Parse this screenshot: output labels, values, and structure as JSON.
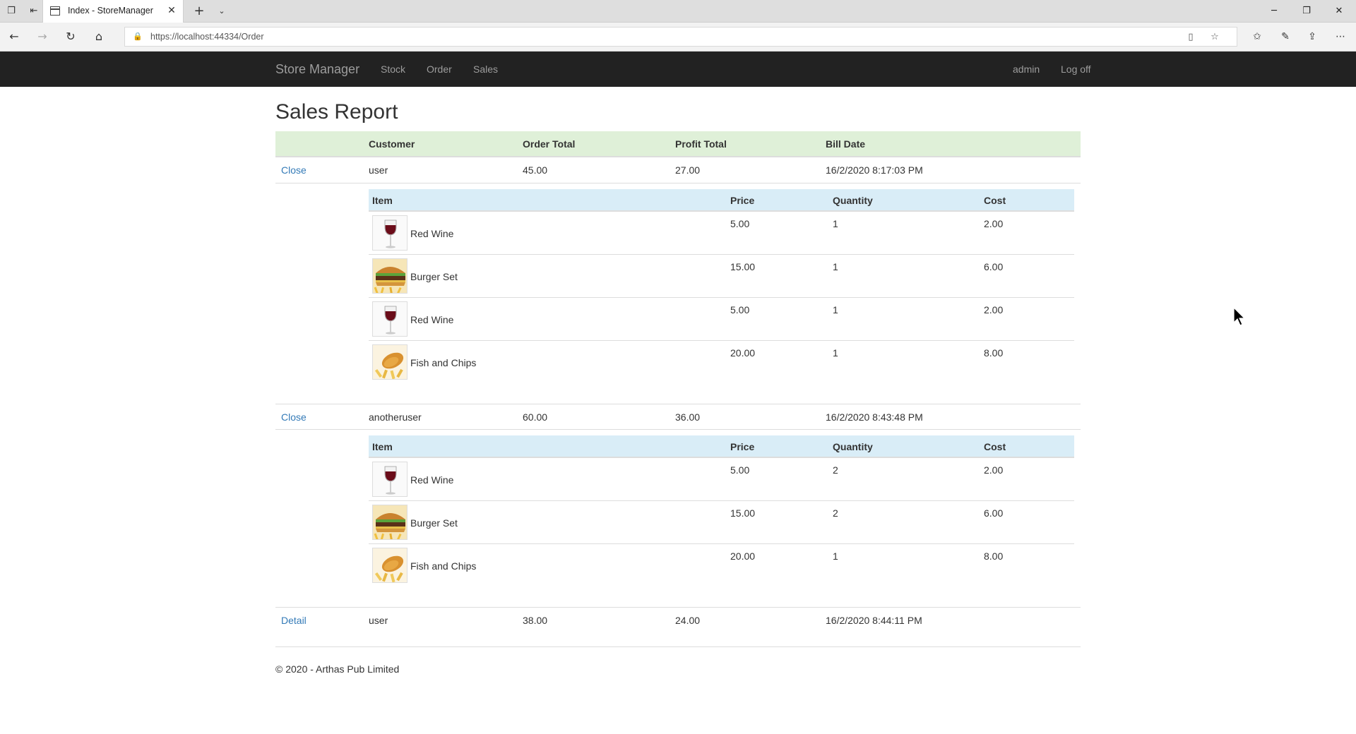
{
  "browser": {
    "tab_title": "Index - StoreManager",
    "url": "https://localhost:44334/Order"
  },
  "navbar": {
    "brand": "Store Manager",
    "links": [
      "Stock",
      "Order",
      "Sales"
    ],
    "user": "admin",
    "logoff": "Log off"
  },
  "page": {
    "title": "Sales Report",
    "columns": {
      "customer": "Customer",
      "order_total": "Order Total",
      "profit_total": "Profit Total",
      "bill_date": "Bill Date"
    },
    "detail_columns": {
      "item": "Item",
      "price": "Price",
      "quantity": "Quantity",
      "cost": "Cost"
    },
    "orders": [
      {
        "toggle": "Close",
        "customer": "user",
        "order_total": "45.00",
        "profit_total": "27.00",
        "bill_date": "16/2/2020 8:17:03 PM",
        "items": [
          {
            "name": "Red Wine",
            "image": "wine-glass",
            "price": "5.00",
            "quantity": "1",
            "cost": "2.00"
          },
          {
            "name": "Burger Set",
            "image": "burger",
            "price": "15.00",
            "quantity": "1",
            "cost": "6.00"
          },
          {
            "name": "Red Wine",
            "image": "wine-glass",
            "price": "5.00",
            "quantity": "1",
            "cost": "2.00"
          },
          {
            "name": "Fish and Chips",
            "image": "fish-and-chips",
            "price": "20.00",
            "quantity": "1",
            "cost": "8.00"
          }
        ]
      },
      {
        "toggle": "Close",
        "customer": "anotheruser",
        "order_total": "60.00",
        "profit_total": "36.00",
        "bill_date": "16/2/2020 8:43:48 PM",
        "items": [
          {
            "name": "Red Wine",
            "image": "wine-glass",
            "price": "5.00",
            "quantity": "2",
            "cost": "2.00"
          },
          {
            "name": "Burger Set",
            "image": "burger",
            "price": "15.00",
            "quantity": "2",
            "cost": "6.00"
          },
          {
            "name": "Fish and Chips",
            "image": "fish-and-chips",
            "price": "20.00",
            "quantity": "1",
            "cost": "8.00"
          }
        ]
      },
      {
        "toggle": "Detail",
        "customer": "user",
        "order_total": "38.00",
        "profit_total": "24.00",
        "bill_date": "16/2/2020 8:44:11 PM",
        "items": []
      }
    ],
    "footer": "© 2020 - Arthas Pub Limited"
  }
}
